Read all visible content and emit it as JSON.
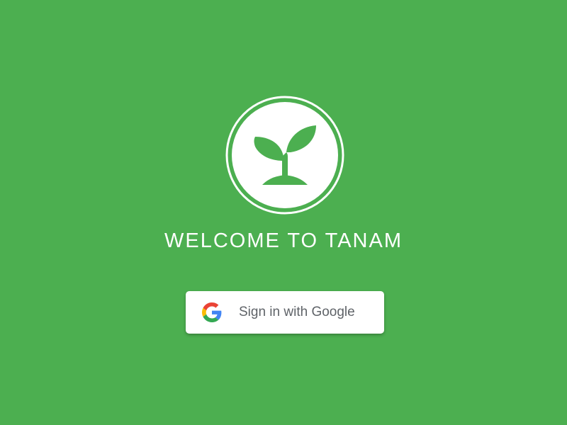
{
  "colors": {
    "background": "#4caf50",
    "logo_fill": "#ffffff",
    "plant": "#4caf50",
    "button_bg": "#ffffff",
    "button_text": "#5f6368"
  },
  "logo": {
    "icon": "sprout-icon"
  },
  "welcome": {
    "title": "WELCOME TO TANAM"
  },
  "signin": {
    "icon": "google-icon",
    "label": "Sign in with Google"
  }
}
